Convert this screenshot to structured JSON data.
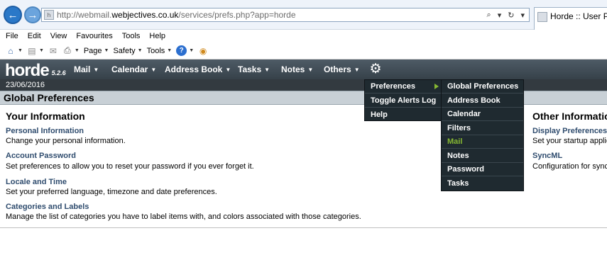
{
  "browser": {
    "url_prefix": "http://webmail.",
    "url_domain": "webjectives.co.uk",
    "url_rest": "/services/prefs.php?app=horde",
    "tab_title": "Horde :: User Preferences",
    "address_tools": [
      "⌕",
      "▾",
      "↻",
      "▾"
    ],
    "menu": [
      "File",
      "Edit",
      "View",
      "Favourites",
      "Tools",
      "Help"
    ],
    "commands": {
      "page": "Page",
      "safety": "Safety",
      "tools": "Tools"
    }
  },
  "horde": {
    "logo": "horde",
    "version": "5.2.6",
    "nav": [
      "Mail",
      "Calendar",
      "Address Book",
      "Tasks",
      "Notes",
      "Others"
    ],
    "date": "23/06/2016",
    "page_title": "Global Preferences"
  },
  "left": {
    "title": "Your Information",
    "items": [
      {
        "link": "Personal Information",
        "desc": "Change your personal information."
      },
      {
        "link": "Account Password",
        "desc": "Set preferences to allow you to reset your password if you ever forget it."
      },
      {
        "link": "Locale and Time",
        "desc": "Set your preferred language, timezone and date preferences."
      },
      {
        "link": "Categories and Labels",
        "desc": "Manage the list of categories you have to label items with, and colors associated with those categories."
      }
    ]
  },
  "right": {
    "title": "Other Information",
    "items": [
      {
        "link": "Display Preferences",
        "desc": "Set your startup application"
      },
      {
        "link": "SyncML",
        "desc": "Configuration for syncing"
      }
    ]
  },
  "menus": {
    "primary": [
      "Preferences",
      "Toggle Alerts Log",
      "Help"
    ],
    "preferences": [
      "Global Preferences",
      "Address Book",
      "Calendar",
      "Filters",
      "Mail",
      "Notes",
      "Password",
      "Tasks"
    ],
    "active_item": "Mail"
  },
  "colors": {
    "horde_bar": "#3f4a54",
    "menu_bg": "#1f2a30",
    "accent": "#86b832",
    "link": "#2f4c6e"
  }
}
